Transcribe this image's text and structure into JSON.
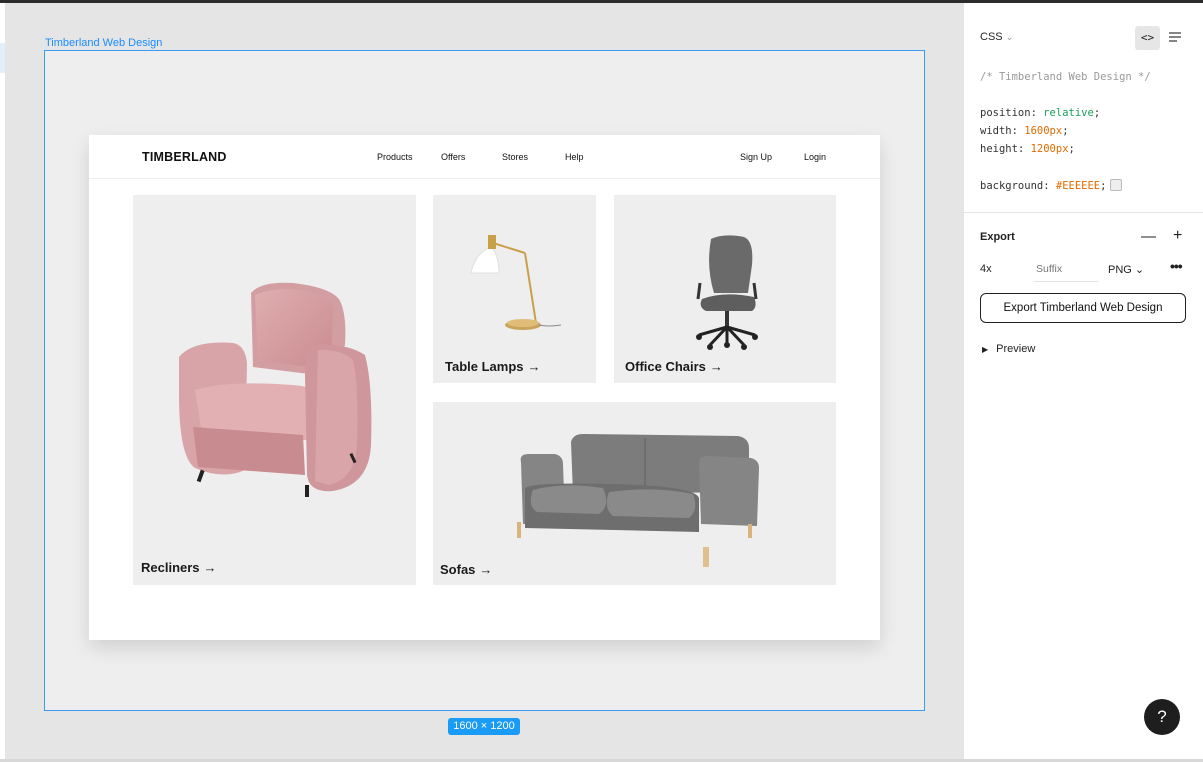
{
  "frame": {
    "label": "Timberland Web Design",
    "size_tag": "1600 × 1200"
  },
  "site": {
    "brand": "TIMBERLAND",
    "nav": [
      "Products",
      "Offers",
      "Stores",
      "Help"
    ],
    "auth": [
      "Sign Up",
      "Login"
    ],
    "cards": [
      {
        "label": "Recliners",
        "arrow": "→",
        "image": "pink-recliner-chair"
      },
      {
        "label": "Table Lamps",
        "arrow": "→",
        "image": "brass-table-lamp"
      },
      {
        "label": "Office Chairs",
        "arrow": "→",
        "image": "grey-office-chair"
      },
      {
        "label": "Sofas",
        "arrow": "→",
        "image": "grey-two-seat-sofa"
      }
    ]
  },
  "panel": {
    "tab": "CSS",
    "tab_caret": "⌄",
    "code_button": "<>",
    "code": {
      "comment": "/* Timberland Web Design */",
      "position_prop": "position",
      "position_val": "relative",
      "width_prop": "width",
      "width_val": "1600px",
      "height_prop": "height",
      "height_val": "1200px",
      "bg_prop": "background",
      "bg_val": "#EEEEEE"
    },
    "export": {
      "title": "Export",
      "minus": "—",
      "plus": "+",
      "scale": "4x",
      "suffix_placeholder": "Suffix",
      "format": "PNG ⌄",
      "more": "•••",
      "button": "Export Timberland Web Design",
      "preview": "Preview",
      "preview_caret": "▶"
    },
    "help": "?"
  },
  "colors": {
    "accent": "#1a9bf5",
    "frame_bg": "#EEEEEE",
    "card_bg": "#eeeeee"
  }
}
